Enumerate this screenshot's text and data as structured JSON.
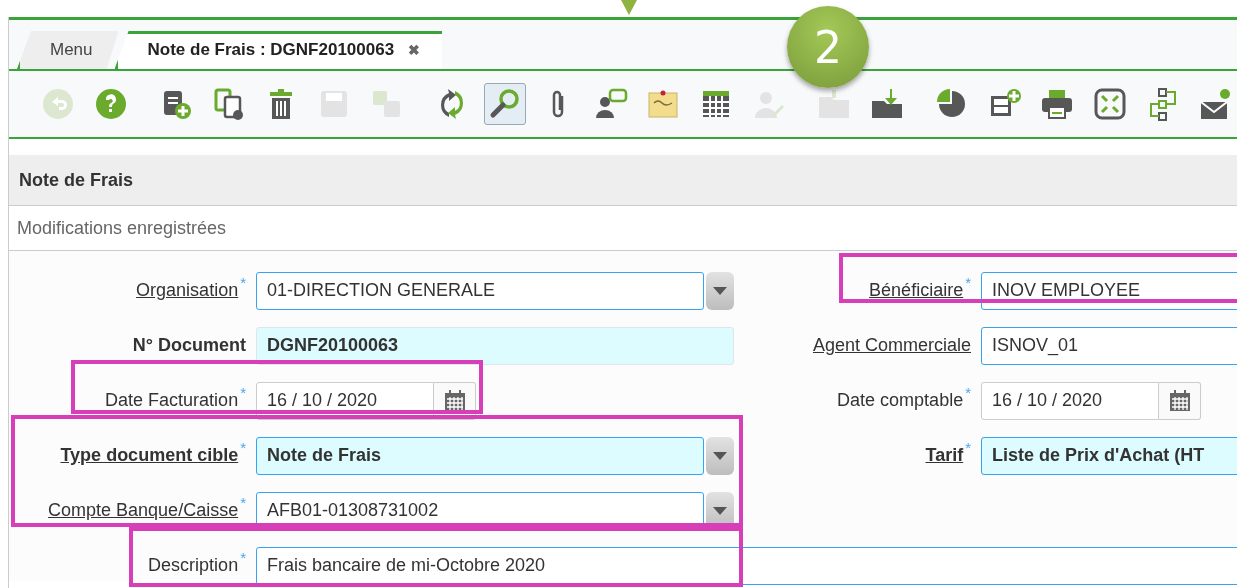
{
  "tabs": [
    {
      "label": "Menu",
      "selected": false
    },
    {
      "label": "Note de Frais : DGNF20100063",
      "selected": true,
      "close_glyph": "✖"
    }
  ],
  "toolbar": [
    {
      "kind": "undo",
      "disabled": true,
      "pressed": false
    },
    {
      "kind": "help",
      "disabled": false,
      "pressed": false
    },
    {
      "kind": "new",
      "disabled": false,
      "pressed": false
    },
    {
      "kind": "copy",
      "disabled": false,
      "pressed": false
    },
    {
      "kind": "delete",
      "disabled": false,
      "pressed": false
    },
    {
      "kind": "save",
      "disabled": true,
      "pressed": false
    },
    {
      "kind": "save-copy",
      "disabled": true,
      "pressed": false
    },
    {
      "kind": "refresh",
      "disabled": false,
      "pressed": false
    },
    {
      "kind": "search",
      "disabled": false,
      "pressed": true
    },
    {
      "kind": "attach",
      "disabled": false,
      "pressed": false
    },
    {
      "kind": "chat",
      "disabled": false,
      "pressed": false
    },
    {
      "kind": "note",
      "disabled": false,
      "pressed": false
    },
    {
      "kind": "grid",
      "disabled": false,
      "pressed": false
    },
    {
      "kind": "user-tool",
      "disabled": true,
      "pressed": false
    },
    {
      "kind": "folder",
      "disabled": true,
      "pressed": false
    },
    {
      "kind": "folder-in",
      "disabled": false,
      "pressed": false
    },
    {
      "kind": "pie",
      "disabled": false,
      "pressed": false
    },
    {
      "kind": "cabinet-add",
      "disabled": false,
      "pressed": false
    },
    {
      "kind": "print",
      "disabled": false,
      "pressed": false
    },
    {
      "kind": "expand",
      "disabled": false,
      "pressed": false
    },
    {
      "kind": "tree",
      "disabled": false,
      "pressed": false
    },
    {
      "kind": "user-mail",
      "disabled": false,
      "pressed": false
    }
  ],
  "callout": {
    "number": "2"
  },
  "section": {
    "title": "Note de Frais",
    "status": "Modifications enregistrées"
  },
  "form": {
    "rows": [
      {
        "left": {
          "label": "Organisation",
          "required_mark": "*",
          "link": true,
          "bold": false,
          "kind": "dropdown",
          "value": "01-DIRECTION GENERALE",
          "tinted": false
        },
        "right": {
          "label": "Bénéficiaire",
          "required_mark": "*",
          "link": true,
          "bold": false,
          "kind": "text",
          "value": "INOV EMPLOYEE",
          "tinted": false
        }
      },
      {
        "left": {
          "label": "N° Document",
          "link": false,
          "bold": true,
          "kind": "readonly",
          "value": "DGNF20100063",
          "tinted": true
        },
        "right": {
          "label": "Agent Commerciale",
          "link": true,
          "bold": false,
          "kind": "text",
          "value": "ISNOV_01",
          "tinted": false
        }
      },
      {
        "left": {
          "label": "Date Facturation",
          "required_mark": "*",
          "link": false,
          "bold": false,
          "kind": "date",
          "value": "16 / 10 / 2020",
          "tinted": false
        },
        "right": {
          "label": "Date comptable",
          "required_mark": "*",
          "link": false,
          "bold": false,
          "kind": "date",
          "value": "16 / 10 / 2020",
          "tinted": false
        }
      },
      {
        "left": {
          "label": "Type document cible",
          "required_mark": "*",
          "link": true,
          "bold": true,
          "kind": "dropdown",
          "value": "Note de Frais",
          "tinted": true
        },
        "right": {
          "label": "Tarif",
          "required_mark": "*",
          "link": true,
          "bold": true,
          "kind": "text",
          "value": "Liste de Prix d'Achat (HT",
          "tinted": true
        }
      },
      {
        "left": {
          "label": "Compte Banque/Caisse",
          "required_mark": "*",
          "link": true,
          "bold": false,
          "kind": "dropdown",
          "value": "AFB01-01308731002",
          "tinted": false
        }
      },
      {
        "wide": {
          "label": "Description",
          "required_mark": "*",
          "link": false,
          "bold": false,
          "kind": "text",
          "value": "Frais bancaire de mi-Octobre 2020",
          "tinted": false
        }
      }
    ]
  }
}
